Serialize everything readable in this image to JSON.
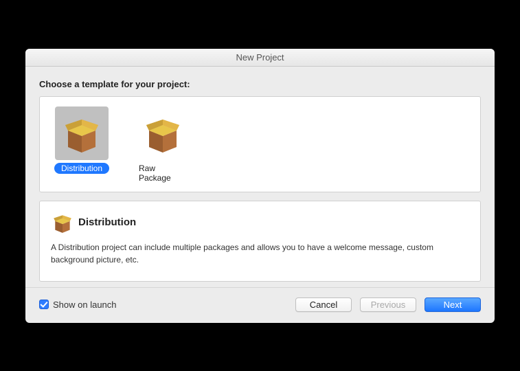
{
  "window": {
    "title": "New Project"
  },
  "heading": "Choose a template for your project:",
  "templates": {
    "items": [
      {
        "label": "Distribution",
        "selected": true
      },
      {
        "label": "Raw Package",
        "selected": false
      }
    ]
  },
  "description": {
    "title": "Distribution",
    "text": "A Distribution project can include multiple packages and allows you to have a welcome message, custom background picture, etc."
  },
  "bottom": {
    "show_on_launch_label": "Show on launch",
    "show_on_launch_checked": true,
    "cancel_label": "Cancel",
    "previous_label": "Previous",
    "next_label": "Next"
  }
}
